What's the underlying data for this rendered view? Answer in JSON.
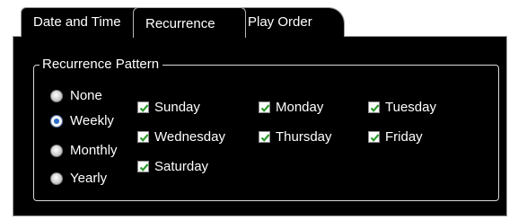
{
  "tabs": [
    {
      "label": "Date and Time",
      "selected": false
    },
    {
      "label": "Recurrence",
      "selected": true
    },
    {
      "label": "Play Order",
      "selected": false
    }
  ],
  "recurrence_pattern": {
    "legend": "Recurrence Pattern",
    "options": [
      {
        "label": "None",
        "checked": false
      },
      {
        "label": "Weekly",
        "checked": true
      },
      {
        "label": "Monthly",
        "checked": false
      },
      {
        "label": "Yearly",
        "checked": false
      }
    ],
    "days": [
      {
        "label": "Sunday",
        "checked": true
      },
      {
        "label": "Monday",
        "checked": true
      },
      {
        "label": "Tuesday",
        "checked": true
      },
      {
        "label": "Wednesday",
        "checked": true
      },
      {
        "label": "Thursday",
        "checked": true
      },
      {
        "label": "Friday",
        "checked": true
      },
      {
        "label": "Saturday",
        "checked": true
      }
    ]
  },
  "colors": {
    "background": "#000000",
    "text": "#ffffff",
    "check": "#2f9a2f",
    "radio_selected": "#2a6cc6"
  }
}
